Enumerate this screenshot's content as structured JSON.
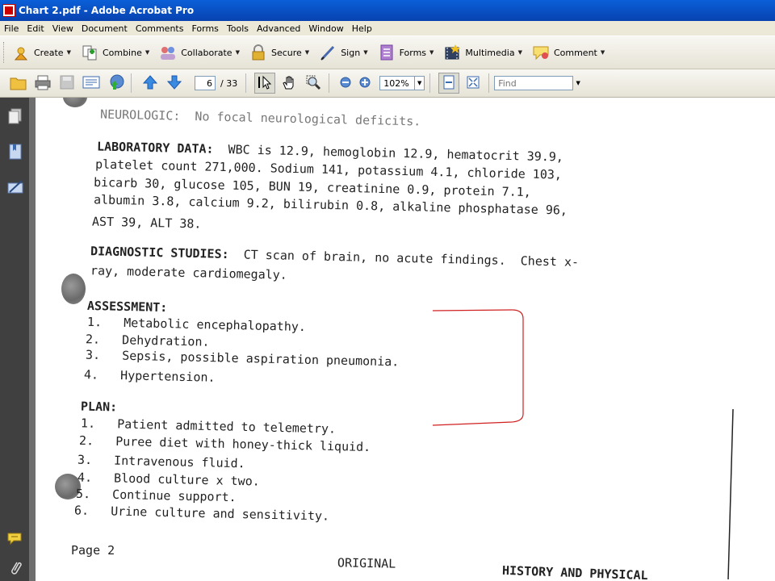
{
  "window": {
    "title": "Chart 2.pdf - Adobe Acrobat Pro"
  },
  "menu": [
    "File",
    "Edit",
    "View",
    "Document",
    "Comments",
    "Forms",
    "Tools",
    "Advanced",
    "Window",
    "Help"
  ],
  "tasks": [
    {
      "label": "Create",
      "icon": "create-icon"
    },
    {
      "label": "Combine",
      "icon": "combine-icon"
    },
    {
      "label": "Collaborate",
      "icon": "collaborate-icon"
    },
    {
      "label": "Secure",
      "icon": "lock-icon"
    },
    {
      "label": "Sign",
      "icon": "pen-icon"
    },
    {
      "label": "Forms",
      "icon": "forms-icon"
    },
    {
      "label": "Multimedia",
      "icon": "multimedia-icon"
    },
    {
      "label": "Comment",
      "icon": "comment-icon"
    }
  ],
  "nav": {
    "page": "6",
    "total": "/ 33",
    "zoom": "102%",
    "find_placeholder": "Find"
  },
  "document": {
    "neuro": "NEUROLOGIC:  No focal neurological deficits.",
    "lab_label": "LABORATORY DATA:",
    "lab1": "WBC is 12.9, hemoglobin 12.9, hematocrit 39.9,",
    "lab2": "platelet count 271,000. Sodium 141, potassium 4.1, chloride 103,",
    "lab3": "bicarb 30, glucose 105, BUN 19, creatinine 0.9, protein 7.1,",
    "lab4": "albumin 3.8, calcium 9.2, bilirubin 0.8, alkaline phosphatase 96,",
    "lab5": "AST 39, ALT 38.",
    "diag_label": "DIAGNOSTIC STUDIES:",
    "diag1": "CT scan of brain, no acute findings.  Chest x-",
    "diag2": "ray, moderate cardiomegaly.",
    "assessment_label": "ASSESSMENT:",
    "assessment": [
      {
        "n": "1.",
        "text": "Metabolic encephalopathy."
      },
      {
        "n": "2.",
        "text": "Dehydration."
      },
      {
        "n": "3.",
        "text": "Sepsis, possible aspiration pneumonia."
      },
      {
        "n": "4.",
        "text": "Hypertension."
      }
    ],
    "plan_label": "PLAN:",
    "plan": [
      {
        "n": "1.",
        "text": "Patient admitted to telemetry."
      },
      {
        "n": "2.",
        "text": "Puree diet with honey-thick liquid."
      },
      {
        "n": "3.",
        "text": "Intravenous fluid."
      },
      {
        "n": "4.",
        "text": "Blood culture x two."
      },
      {
        "n": "5.",
        "text": "Continue support."
      },
      {
        "n": "6.",
        "text": "Urine culture and sensitivity."
      }
    ],
    "page_label": "Page 2",
    "original": "ORIGINAL",
    "footer_title": "HISTORY AND PHYSICAL"
  }
}
